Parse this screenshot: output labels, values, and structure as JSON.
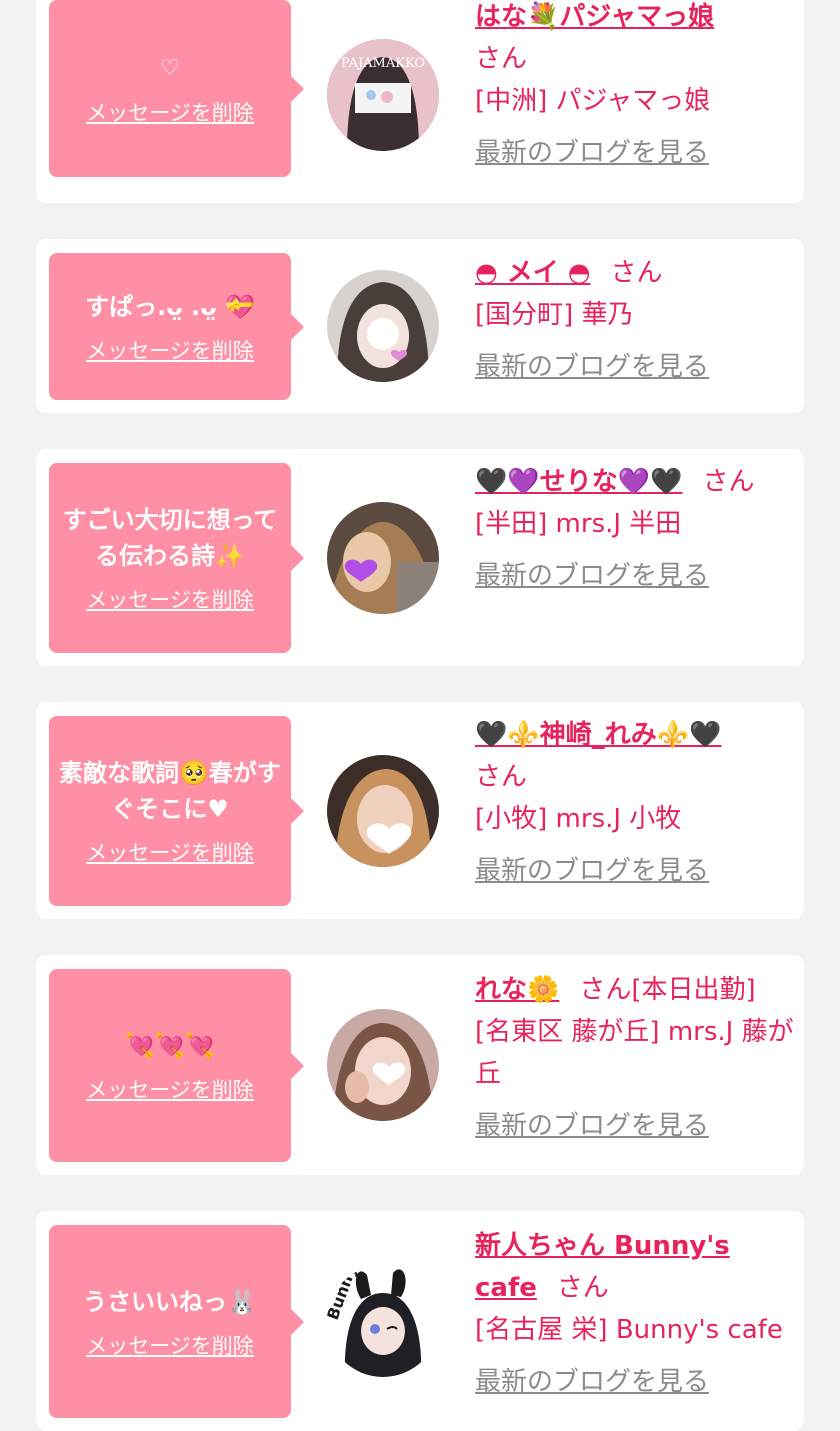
{
  "cards": [
    {
      "message": "♡",
      "delete_label": "メッセージを削除",
      "name": "はな💐パジャマっ娘",
      "suffix": "さん",
      "shop": "[中洲] パジャマっ娘",
      "blog_label": "最新のブログを見る",
      "avatar_text": "PAJAMAKKO"
    },
    {
      "message": "すぱっ.ᴗ̤ .ᴗ̤ 💝",
      "delete_label": "メッセージを削除",
      "name": "◓ メイ ◓",
      "suffix": "さん",
      "shop": "[国分町] 華乃",
      "blog_label": "最新のブログを見る"
    },
    {
      "message": "すごい大切に想ってる伝わる詩✨",
      "delete_label": "メッセージを削除",
      "name": "🖤💜せりな💜🖤",
      "suffix": "さん",
      "shop": "[半田] mrs.J 半田",
      "blog_label": "最新のブログを見る"
    },
    {
      "message": "素敵な歌詞🥺春がすぐそこに♥",
      "delete_label": "メッセージを削除",
      "name": "🖤⚜️神崎_れみ⚜️🖤",
      "suffix": "さん",
      "shop": "[小牧] mrs.J 小牧",
      "blog_label": "最新のブログを見る"
    },
    {
      "message": "💘💘💘",
      "delete_label": "メッセージを削除",
      "name": "れな🌼",
      "suffix": "さん",
      "badge": "[本日出勤]",
      "shop": "[名東区 藤が丘] mrs.J 藤が丘",
      "blog_label": "最新のブログを見る"
    },
    {
      "message": "うさいいねっ🐰",
      "delete_label": "メッセージを削除",
      "name": "新人ちゃん Bunny's cafe",
      "suffix": "さん",
      "shop": "[名古屋 栄] Bunny's cafe",
      "blog_label": "最新のブログを見る",
      "avatar_text": "Bunny"
    }
  ],
  "colors": {
    "page_bg": "#f2f2f2",
    "card_bg": "#ffffff",
    "bubble_bg": "#fe8fa4",
    "name_color": "#e6245b",
    "blog_link_color": "#8b8b8b"
  }
}
